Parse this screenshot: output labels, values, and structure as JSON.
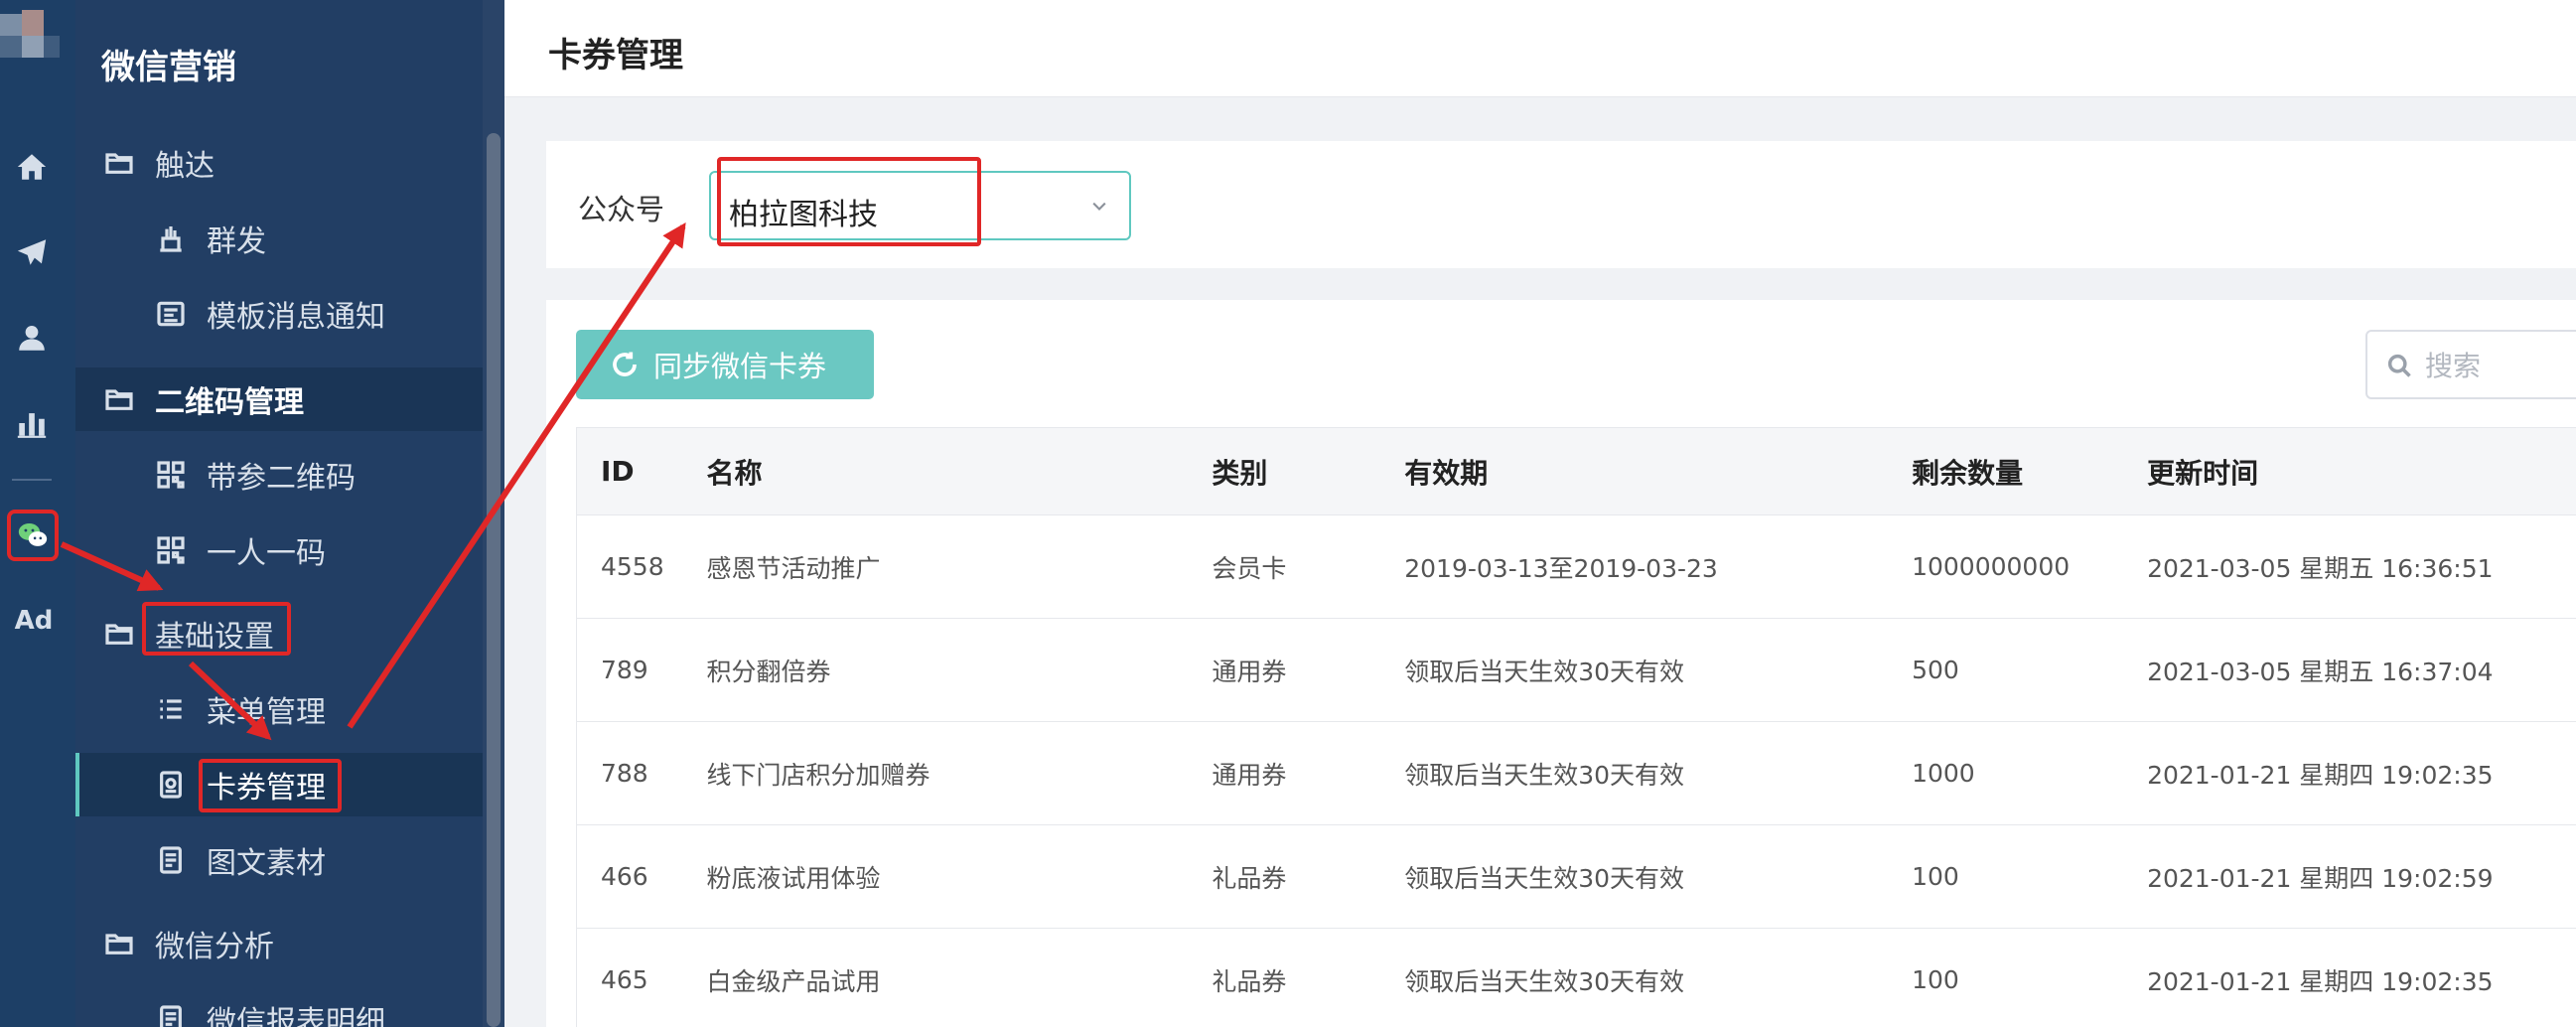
{
  "sidebar": {
    "title": "微信营销",
    "groups": [
      {
        "label": "触达",
        "items": [
          "群发",
          "模板消息通知"
        ]
      },
      {
        "label": "二维码管理",
        "items": [
          "带参二维码",
          "一人一码"
        ]
      },
      {
        "label": "基础设置",
        "items": [
          "菜单管理",
          "卡券管理",
          "图文素材"
        ]
      },
      {
        "label": "微信分析",
        "items": [
          "微信报表明细"
        ]
      }
    ],
    "active_item": "卡券管理"
  },
  "rail": {
    "icons": [
      "home-icon",
      "send-icon",
      "user-icon",
      "bar-chart-icon",
      "wechat-icon"
    ],
    "ad_label": "Ad"
  },
  "header": {
    "title": "卡券管理"
  },
  "filter": {
    "label": "公众号",
    "selected": "柏拉图科技"
  },
  "toolbar": {
    "sync_label": "同步微信卡券",
    "search_placeholder": "搜索"
  },
  "table": {
    "columns": [
      "ID",
      "名称",
      "类别",
      "有效期",
      "剩余数量",
      "更新时间"
    ],
    "rows": [
      [
        "4558",
        "感恩节活动推广",
        "会员卡",
        "2019-03-13至2019-03-23",
        "1000000000",
        "2021-03-05 星期五 16:36:51"
      ],
      [
        "789",
        "积分翻倍券",
        "通用券",
        "领取后当天生效30天有效",
        "500",
        "2021-03-05 星期五 16:37:04"
      ],
      [
        "788",
        "线下门店积分加赠券",
        "通用券",
        "领取后当天生效30天有效",
        "1000",
        "2021-01-21 星期四 19:02:35"
      ],
      [
        "466",
        "粉底液试用体验",
        "礼品券",
        "领取后当天生效30天有效",
        "100",
        "2021-01-21 星期四 19:02:59"
      ],
      [
        "465",
        "白金级产品试用",
        "礼品券",
        "领取后当天生效30天有效",
        "100",
        "2021-01-21 星期四 19:02:35"
      ]
    ]
  },
  "colors": {
    "sidebar_bg": "#223e64",
    "rail_bg": "#1d3f66",
    "accent": "#6bc8c2",
    "annotation": "#e02727"
  }
}
